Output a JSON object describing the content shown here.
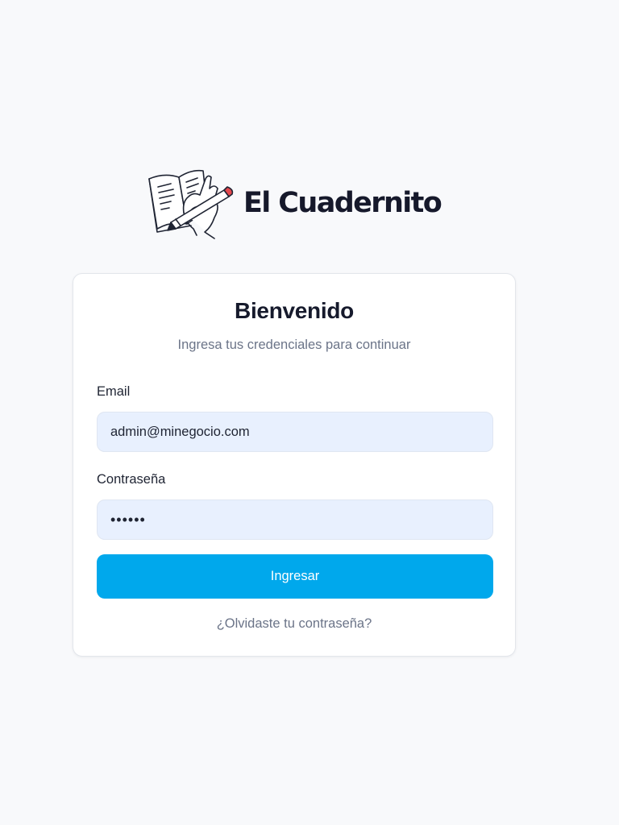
{
  "brand": {
    "name": "El Cuadernito",
    "logo_icon": "notebook-hand-pencil-icon"
  },
  "login": {
    "title": "Bienvenido",
    "subtitle": "Ingresa tus credenciales para continuar",
    "email_label": "Email",
    "email_value": "admin@minegocio.com",
    "password_label": "Contraseña",
    "password_value": "••••••",
    "submit_label": "Ingresar",
    "forgot_link": "¿Olvidaste tu contraseña?"
  },
  "colors": {
    "background": "#f8f9fb",
    "card": "#ffffff",
    "primary_button": "#00a8ec",
    "input_fill": "#e8f0fe",
    "heading_text": "#161a2c",
    "muted_text": "#6b7488",
    "logo_pencil_tip": "#e5484d"
  }
}
